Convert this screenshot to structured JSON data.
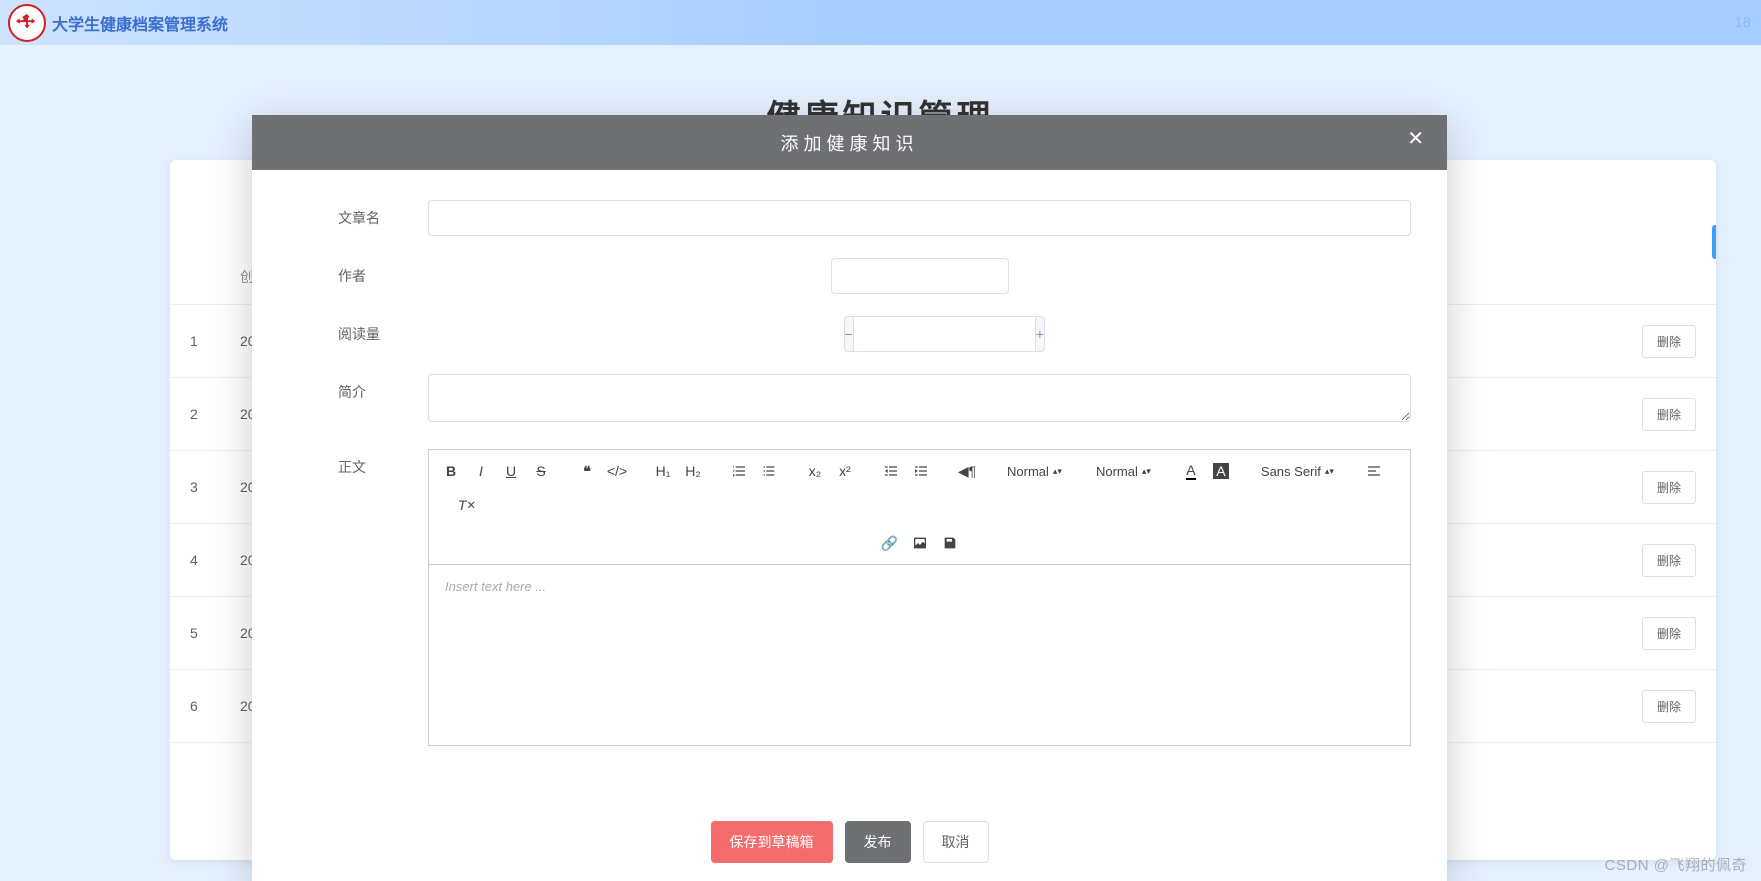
{
  "header": {
    "system_name": "大学生健康档案管理系统",
    "right_text": "18"
  },
  "page_title": "健康知识管理",
  "bg_table": {
    "col_create": "创",
    "rows": [
      {
        "idx": "1",
        "date": "20",
        "del": "删除"
      },
      {
        "idx": "2",
        "date": "20",
        "del": "删除"
      },
      {
        "idx": "3",
        "date": "20",
        "del": "删除"
      },
      {
        "idx": "4",
        "date": "20",
        "del": "删除"
      },
      {
        "idx": "5",
        "date": "20",
        "del": "删除"
      },
      {
        "idx": "6",
        "date": "20",
        "del": "删除"
      }
    ]
  },
  "modal": {
    "title": "添加健康知识",
    "labels": {
      "article_name": "文章名",
      "author": "作者",
      "views": "阅读量",
      "summary": "简介",
      "body": "正文"
    },
    "editor": {
      "placeholder": "Insert text here ...",
      "header_normal": "Normal",
      "size_normal": "Normal",
      "font_default": "Sans Serif"
    },
    "footer": {
      "draft": "保存到草稿箱",
      "publish": "发布",
      "cancel": "取消"
    }
  },
  "watermark": "CSDN @飞翔的佩奇"
}
